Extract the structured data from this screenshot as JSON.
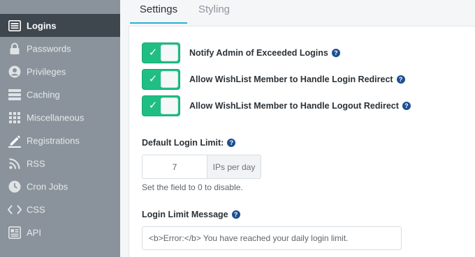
{
  "sidebar": {
    "items": [
      {
        "label": "Logins",
        "icon": "list-icon",
        "active": true
      },
      {
        "label": "Passwords",
        "icon": "lock-icon",
        "active": false
      },
      {
        "label": "Privileges",
        "icon": "user-circle-icon",
        "active": false
      },
      {
        "label": "Caching",
        "icon": "server-icon",
        "active": false
      },
      {
        "label": "Miscellaneous",
        "icon": "grid-icon",
        "active": false
      },
      {
        "label": "Registrations",
        "icon": "pencil-icon",
        "active": false
      },
      {
        "label": "RSS",
        "icon": "rss-icon",
        "active": false
      },
      {
        "label": "Cron Jobs",
        "icon": "clock-icon",
        "active": false
      },
      {
        "label": "CSS",
        "icon": "code-icon",
        "active": false
      },
      {
        "label": "API",
        "icon": "api-icon",
        "active": false
      }
    ]
  },
  "tabs": {
    "settings": "Settings",
    "styling": "Styling",
    "active": "settings"
  },
  "toggles": [
    {
      "label": "Notify Admin of Exceeded Logins",
      "on": true
    },
    {
      "label": "Allow WishList Member to Handle Login Redirect",
      "on": true
    },
    {
      "label": "Allow WishList Member to Handle Logout Redirect",
      "on": true
    }
  ],
  "login_limit": {
    "label": "Default Login Limit:",
    "value": "7",
    "unit": "IPs per day",
    "hint": "Set the field to 0 to disable."
  },
  "limit_message": {
    "label": "Login Limit Message",
    "value": "<b>Error:</b> You have reached your daily login limit."
  },
  "colors": {
    "sidebar_bg": "#8a939b",
    "sidebar_active_bg": "#3e464e",
    "toggle_on": "#1fbf84",
    "help_icon": "#1d4f91",
    "tab_underline": "#2ab0d8"
  },
  "symbols": {
    "check": "✓",
    "help": "?"
  }
}
